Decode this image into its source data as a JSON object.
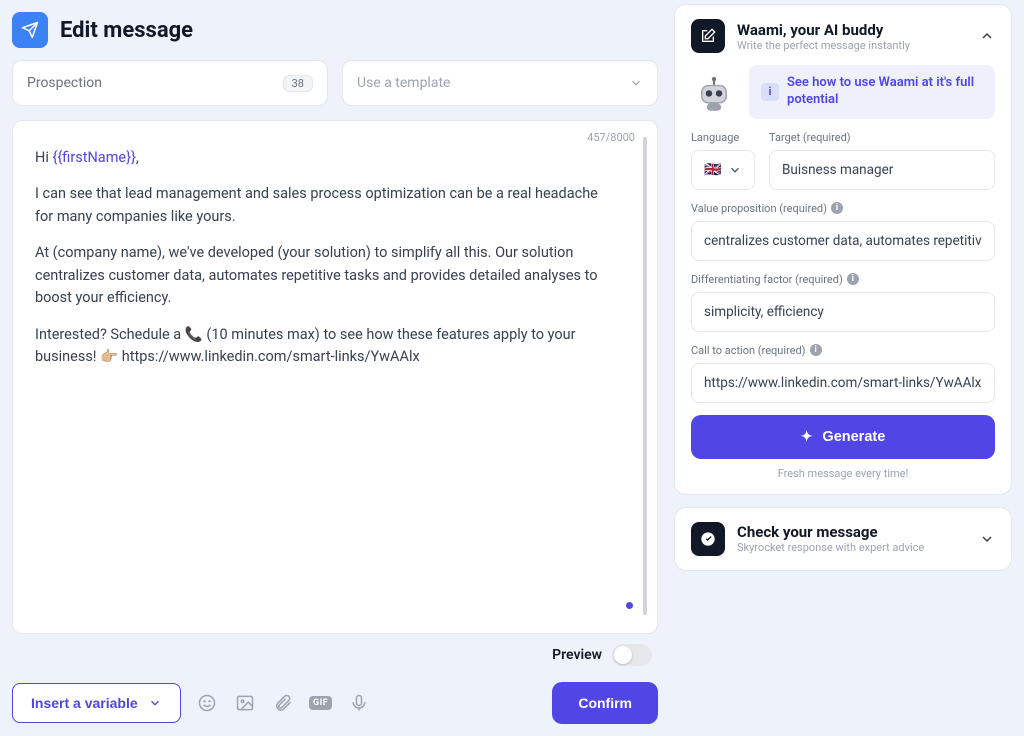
{
  "header": {
    "title": "Edit message"
  },
  "subject": {
    "value": "Prospection",
    "length": "38"
  },
  "template": {
    "placeholder": "Use a template"
  },
  "editor": {
    "char_count": "457/8000",
    "greeting_prefix": "Hi ",
    "greeting_var": "{{firstName}}",
    "greeting_suffix": ",",
    "para1": "I can see that lead management and sales process optimization can be a real headache for many companies like yours.",
    "para2": "At (company name), we've developed (your solution) to simplify all this. Our solution centralizes customer data, automates repetitive tasks and provides detailed analyses to boost your efficiency.",
    "para3": "Interested? Schedule a 📞 (10 minutes max) to see how these features apply to your business! 👉🏼 https://www.linkedin.com/smart-links/YwAAlx"
  },
  "preview": {
    "label": "Preview"
  },
  "toolbar": {
    "insert_variable": "Insert a variable",
    "gif": "GIF"
  },
  "confirm_label": "Confirm",
  "waami": {
    "title": "Waami, your AI buddy",
    "subtitle": "Write the perfect message instantly",
    "tip": "See how to use Waami at it's full potential",
    "labels": {
      "language": "Language",
      "target": "Target (required)",
      "value_prop": "Value proposition (required)",
      "diff": "Differentiating factor (required)",
      "cta": "Call to action (required)"
    },
    "values": {
      "flag": "🇬🇧",
      "target": "Buisness manager",
      "value_prop": "centralizes customer data, automates repetitive tasks",
      "diff": "simplicity, efficiency",
      "cta": "https://www.linkedin.com/smart-links/YwAAlx"
    },
    "generate": "Generate",
    "fresh": "Fresh message every time!"
  },
  "check": {
    "title": "Check your message",
    "subtitle": "Skyrocket response with expert advice"
  }
}
